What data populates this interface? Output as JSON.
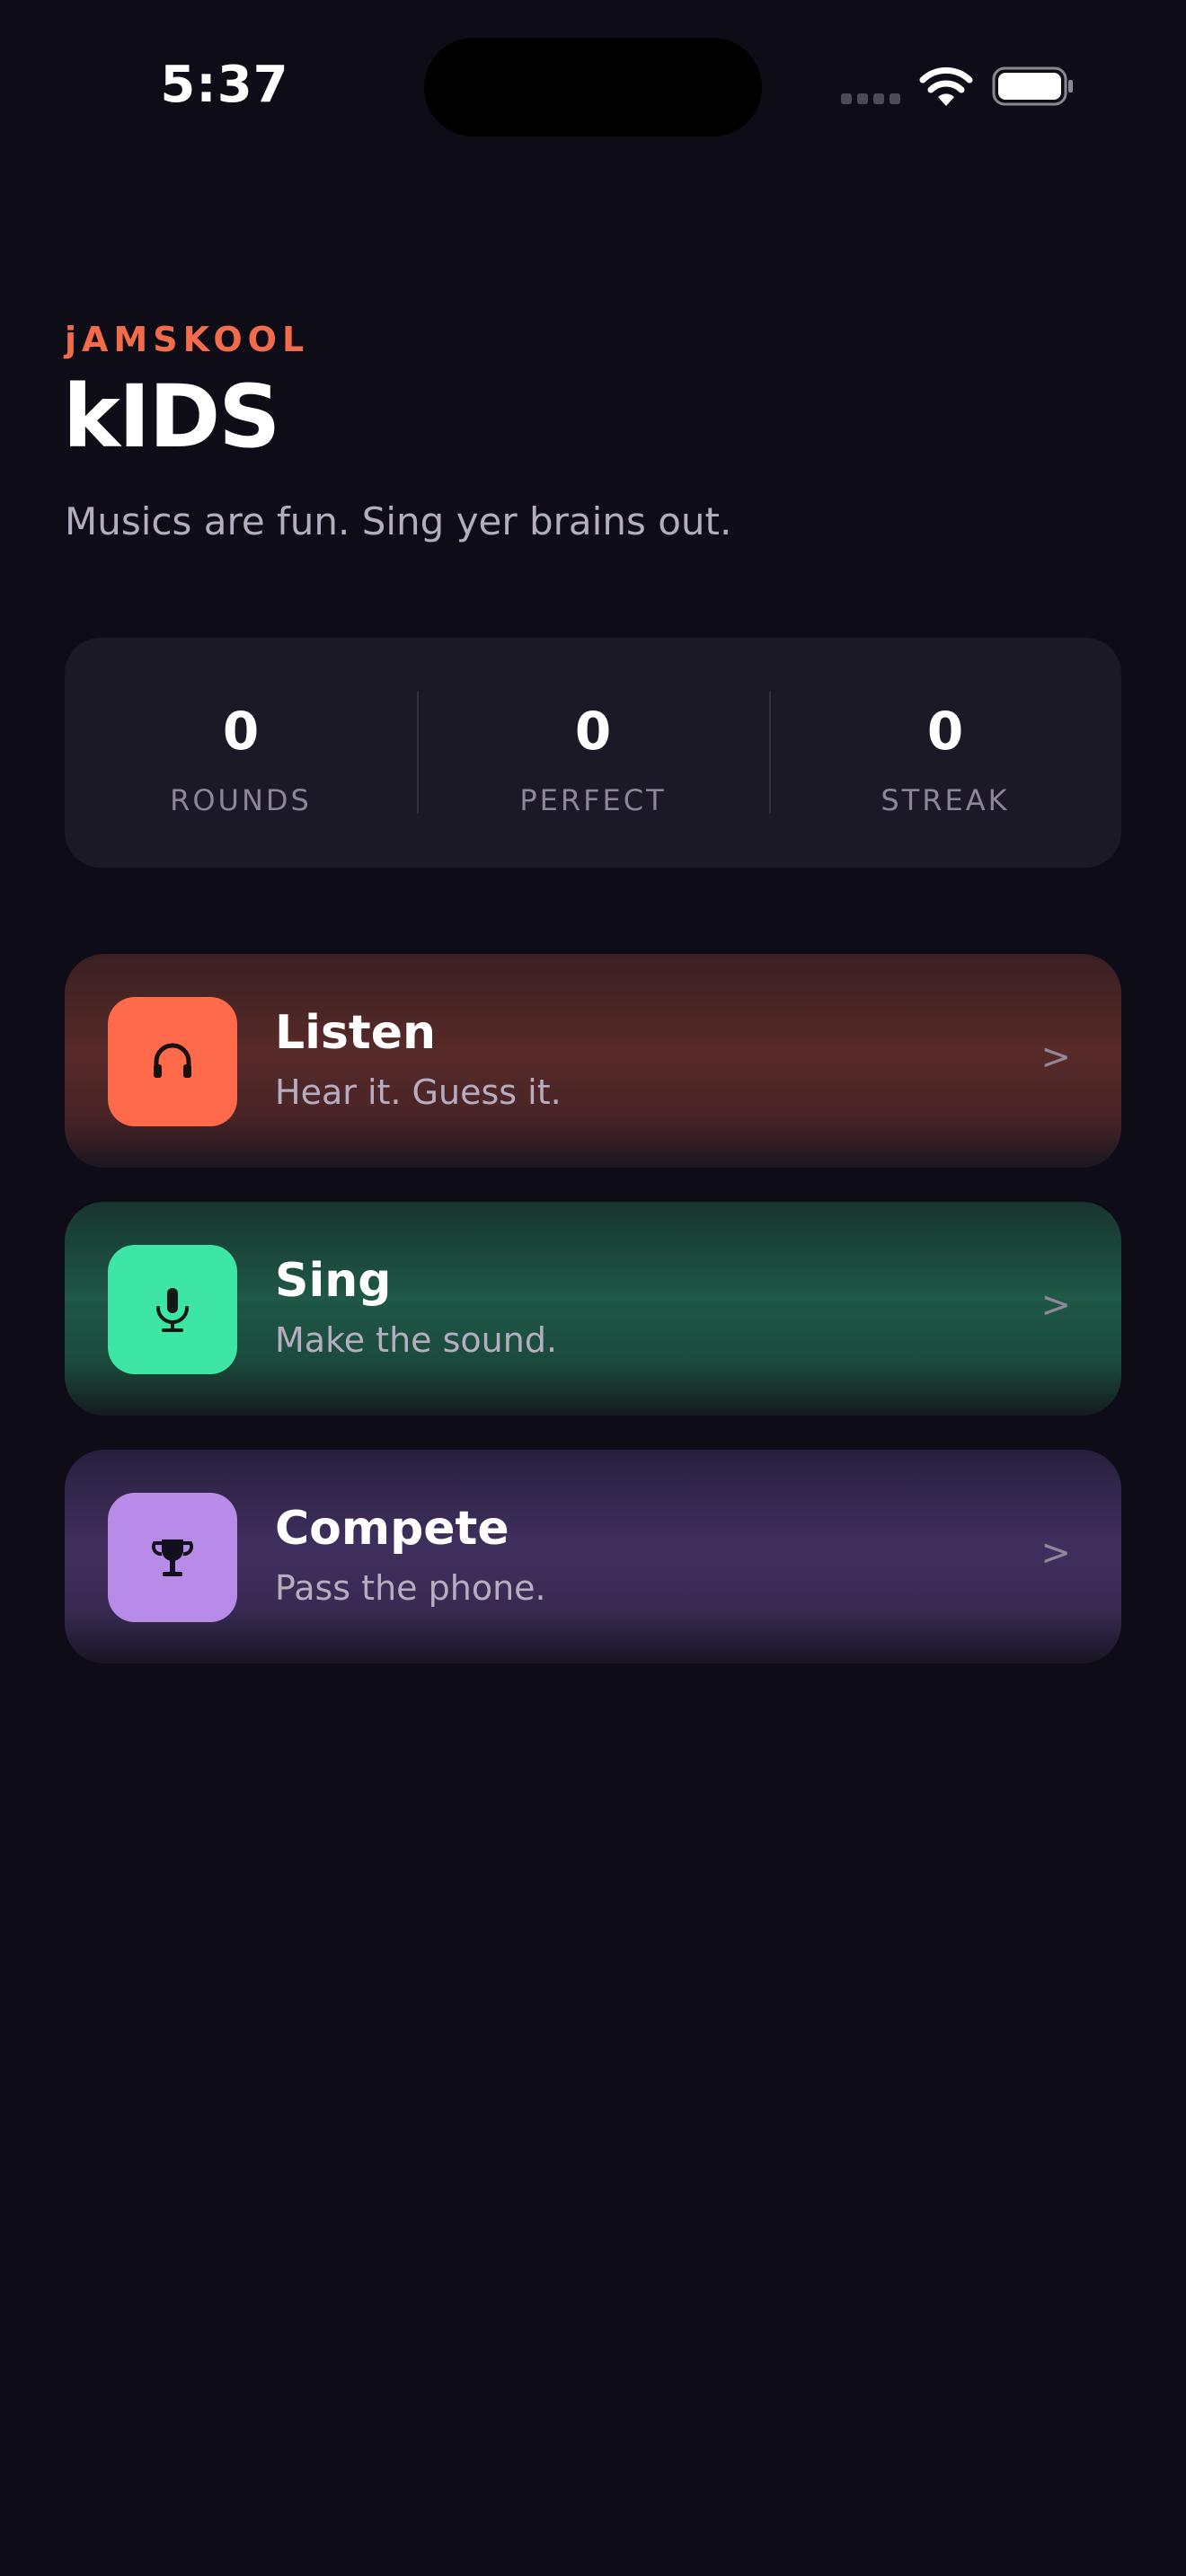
{
  "status_bar": {
    "time": "5:37"
  },
  "header": {
    "brand": "jAMSKOOL",
    "title": "kIDS",
    "tagline": "Musics are fun. Sing yer brains out."
  },
  "stats": [
    {
      "value": "0",
      "label": "ROUNDS"
    },
    {
      "value": "0",
      "label": "PERFECT"
    },
    {
      "value": "0",
      "label": "STREAK"
    }
  ],
  "modes": [
    {
      "title": "Listen",
      "subtitle": "Hear it. Guess it.",
      "icon": "headphones-icon",
      "accent": "#ff6a4a",
      "chevron": ">"
    },
    {
      "title": "Sing",
      "subtitle": "Make the sound.",
      "icon": "microphone-icon",
      "accent": "#3ee6a6",
      "chevron": ">"
    },
    {
      "title": "Compete",
      "subtitle": "Pass the phone.",
      "icon": "trophy-icon",
      "accent": "#b98be8",
      "chevron": ">"
    }
  ],
  "colors": {
    "background": "#0e0c16",
    "brand_accent": "#f26b4b",
    "card": "#1c1926"
  }
}
